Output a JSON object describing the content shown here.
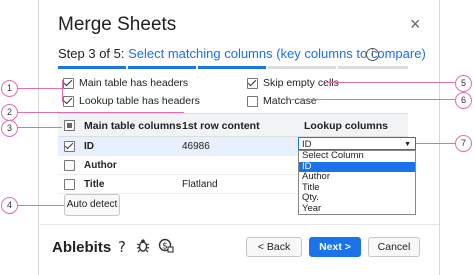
{
  "dialog": {
    "title": "Merge Sheets",
    "close": "×",
    "step_prefix": "Step 3 of 5: ",
    "step_text": "Select matching columns (key columns to compare)",
    "info": "i"
  },
  "options": {
    "main_headers": {
      "label": "Main table has headers",
      "checked": true
    },
    "lookup_headers": {
      "label": "Lookup table has headers",
      "checked": true
    },
    "skip_empty": {
      "label": "Skip empty cells",
      "checked": true
    },
    "match_case": {
      "label": "Match case",
      "checked": false
    }
  },
  "table": {
    "headers": [
      "Main table columns",
      "1st row content",
      "Lookup columns"
    ],
    "rows": [
      {
        "name": "ID",
        "content": "46986",
        "checked": true,
        "lookup": "ID"
      },
      {
        "name": "Author",
        "content": "",
        "checked": false,
        "lookup": ""
      },
      {
        "name": "Title",
        "content": "Flatland",
        "checked": false,
        "lookup": ""
      }
    ]
  },
  "lookup_select": {
    "value": "ID",
    "options": [
      "Select Column",
      "ID",
      "Author",
      "Title",
      "Qty.",
      "Year"
    ],
    "highlighted": "ID"
  },
  "buttons": {
    "auto_detect": "Auto detect",
    "back": "< Back",
    "next": "Next >",
    "cancel": "Cancel"
  },
  "footer": {
    "brand": "Ablebits",
    "icons": [
      "help-icon",
      "bug-icon",
      "privacy-icon"
    ]
  },
  "callouts": [
    "1",
    "2",
    "3",
    "4",
    "5",
    "6",
    "7"
  ],
  "colors": {
    "accent": "#1a73e8",
    "callout": "#e06fb2",
    "selected_row": "#e8f0fe"
  }
}
